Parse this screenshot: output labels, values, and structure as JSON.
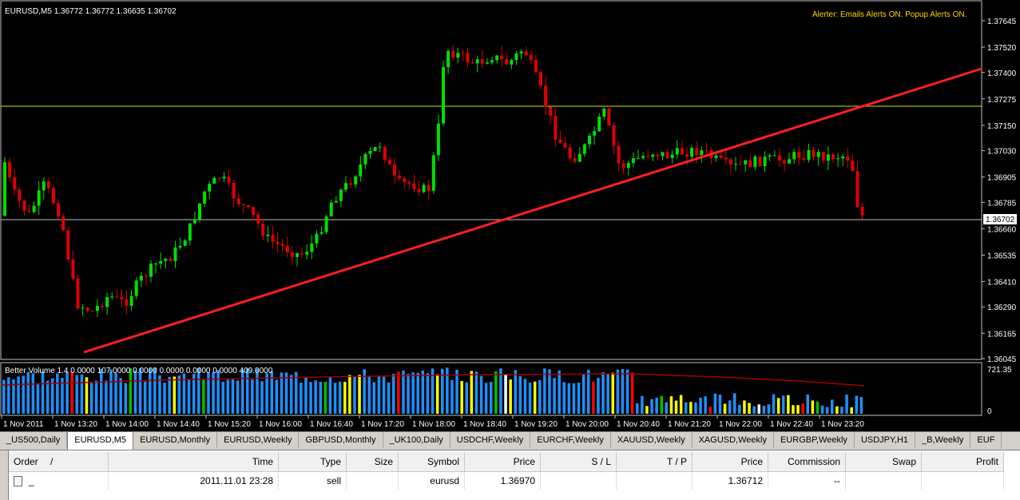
{
  "chart": {
    "symbol_label": "EURUSD,M5",
    "ohlc_label": "1.36772 1.36772 1.36635 1.36702",
    "alerter_text": "Alerter:  Emails Alerts ON.  Popup Alerts ON.",
    "current_price": "1.36702",
    "price_ticks": [
      "1.37645",
      "1.37520",
      "1.37400",
      "1.37275",
      "1.37150",
      "1.37030",
      "1.36905",
      "1.36785",
      "1.36660",
      "1.36535",
      "1.36410",
      "1.36290",
      "1.36165",
      "1.36045"
    ],
    "time_ticks": [
      "1 Nov 2011",
      "1 Nov 13:20",
      "1 Nov 14:00",
      "1 Nov 14:40",
      "1 Nov 15:20",
      "1 Nov 16:00",
      "1 Nov 16:40",
      "1 Nov 17:20",
      "1 Nov 18:00",
      "1 Nov 18:40",
      "1 Nov 19:20",
      "1 Nov 20:00",
      "1 Nov 20:40",
      "1 Nov 21:20",
      "1 Nov 22:00",
      "1 Nov 22:40",
      "1 Nov 23:20"
    ],
    "volume_label": "Better Volume 1.4 0.0000 107.0000 0.0000 0.0000 0.0000 0.0000 409.0000",
    "volume_ticks": [
      "721.35",
      "0"
    ],
    "colors": {
      "bull": "#00e000",
      "bear": "#e00000",
      "trend": "#ff2020",
      "hline": "#e0e000",
      "grid": "#c0c0c0"
    }
  },
  "tabs": [
    "_US500,Daily",
    "EURUSD,M5",
    "EURUSD,Monthly",
    "EURUSD,Weekly",
    "GBPUSD,Monthly",
    "_UK100,Daily",
    "USDCHF,Weekly",
    "EURCHF,Weekly",
    "XAUUSD,Weekly",
    "XAGUSD,Weekly",
    "EURGBP,Weekly",
    "USDJPY,H1",
    "_B,Weekly",
    "EUF"
  ],
  "active_tab": "EURUSD,M5",
  "terminal": {
    "headers": {
      "order": "Order",
      "sort": "/",
      "time": "Time",
      "type": "Type",
      "size": "Size",
      "symbol": "Symbol",
      "price": "Price",
      "sl": "S / L",
      "tp": "T / P",
      "price2": "Price",
      "commission": "Commission",
      "swap": "Swap",
      "profit": "Profit"
    },
    "row": {
      "order": "_",
      "time": "2011.11.01 23:28",
      "type": "sell",
      "size": "",
      "symbol": "eurusd",
      "price": "1.36970",
      "sl": "",
      "tp": "",
      "price2": "1.36712",
      "commission": "--",
      "swap": "",
      "profit": ""
    }
  }
}
